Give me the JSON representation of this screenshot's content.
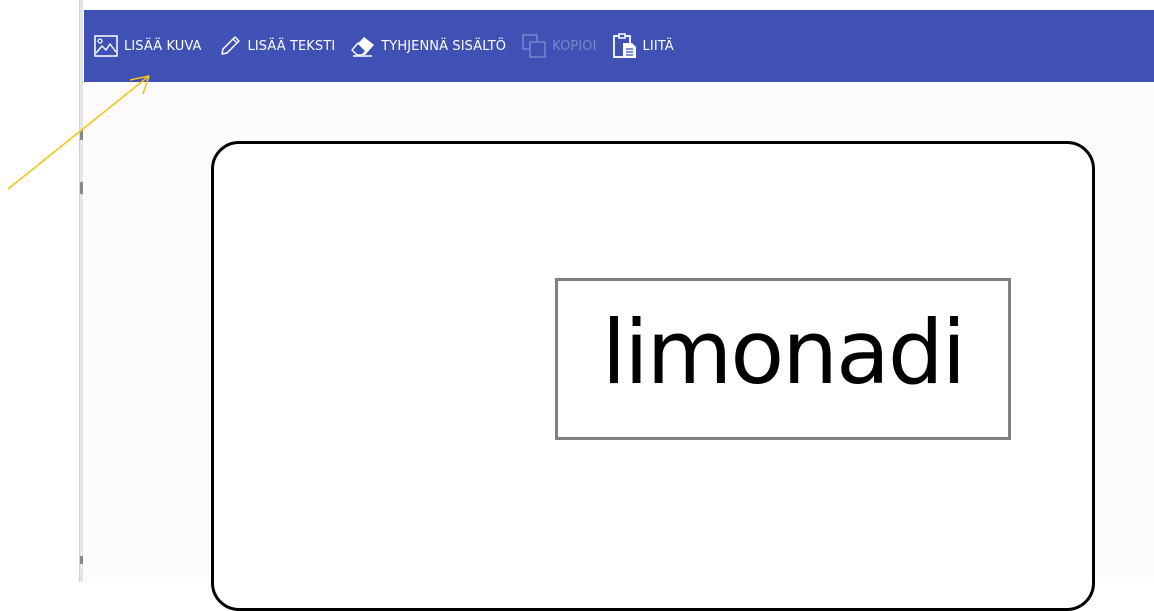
{
  "toolbar": {
    "background": "#3f51b5",
    "buttons": [
      {
        "label": "LISÄÄ KUVA",
        "icon": "image-icon",
        "enabled": true
      },
      {
        "label": "LISÄÄ TEKSTI",
        "icon": "pencil-icon",
        "enabled": true
      },
      {
        "label": "TYHJENNÄ SISÄLTÖ",
        "icon": "eraser-icon",
        "enabled": true
      },
      {
        "label": "KOPIOI",
        "icon": "copy-icon",
        "enabled": false
      },
      {
        "label": "LIITÄ",
        "icon": "paste-icon",
        "enabled": true
      }
    ]
  },
  "canvas": {
    "text_element": "limonadi"
  },
  "annotation": {
    "color": "#f5c518",
    "target": "add-image-button"
  }
}
